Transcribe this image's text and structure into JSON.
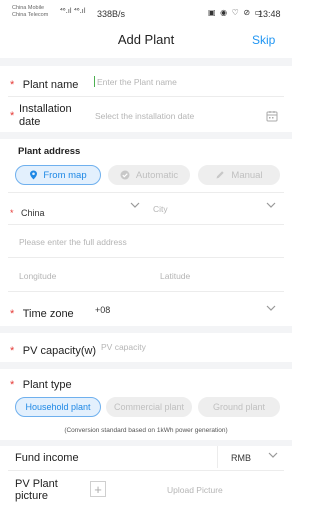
{
  "status_bar": {
    "carrier_1": "China Mobile",
    "carrier_2": "China Telecom",
    "signal": "⁴⁶.ıl ⁴⁶.ıl",
    "net_speed": "338B/s",
    "icons": "▣ ◉ ♡ ⊘ ▭",
    "battery": "",
    "time": "13:48"
  },
  "header": {
    "title": "Add Plant",
    "skip": "Skip"
  },
  "required_mark": "*",
  "fields": {
    "plant_name": {
      "label": "Plant name",
      "placeholder": "Enter the Plant name"
    },
    "installation_date": {
      "label_line1": "Installation",
      "label_line2": "date",
      "placeholder": "Select the installation date"
    },
    "plant_address": {
      "label": "Plant address",
      "options": [
        "From map",
        "Automatic",
        "Manual"
      ],
      "selected": "From map"
    },
    "country": {
      "value": "China"
    },
    "city": {
      "placeholder": "City"
    },
    "full_address": {
      "placeholder": "Please enter the full address"
    },
    "longitude": {
      "placeholder": "Longitude"
    },
    "latitude": {
      "placeholder": "Latitude"
    },
    "time_zone": {
      "label": "Time zone",
      "value": "+08"
    },
    "pv_capacity": {
      "label": "PV capacity(w)",
      "placeholder": "PV capacity"
    },
    "plant_type": {
      "label": "Plant type",
      "options": [
        "Household plant",
        "Commercial plant",
        "Ground plant"
      ],
      "selected": "Household plant",
      "note": "(Conversion standard based on 1kWh power generation)"
    },
    "fund_income": {
      "label": "Fund income",
      "currency": "RMB"
    },
    "plant_picture": {
      "label_line1": "PV Plant",
      "label_line2": "picture",
      "upload": "Upload Picture",
      "add_symbol": "+"
    }
  },
  "icons": {
    "calendar": "calendar-icon",
    "location": "location-pin-icon",
    "check": "check-circle-icon",
    "pencil": "pencil-icon",
    "chevron": "chevron-down-icon"
  },
  "colors": {
    "accent": "#2196f3",
    "required": "#e53935",
    "pill_selected_bg": "#e3f0fd",
    "pill_off_bg": "#eeeeee"
  }
}
